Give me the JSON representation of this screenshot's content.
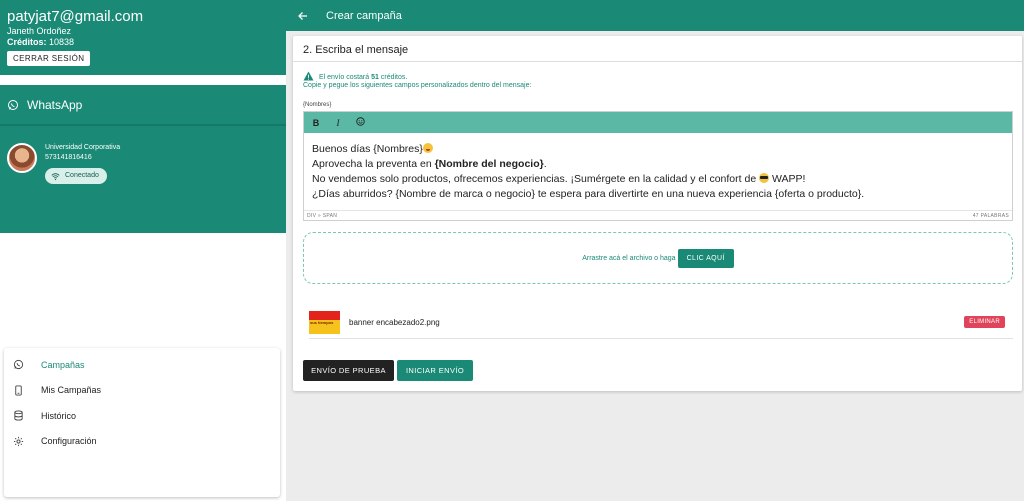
{
  "account": {
    "email": "patyjat7@gmail.com",
    "name": "Janeth Ordoñez",
    "credits_label": "Créditos:",
    "credits_value": "10838",
    "logout_label": "CERRAR SESIÓN"
  },
  "whatsapp": {
    "title": "WhatsApp",
    "org_name": "Universidad Corporativa",
    "phone": "573141816416",
    "status": "Conectado"
  },
  "menu": {
    "items": [
      {
        "label": "Campañas",
        "icon": "whatsapp-icon"
      },
      {
        "label": "Mis Campañas",
        "icon": "phone-icon"
      },
      {
        "label": "Histórico",
        "icon": "database-icon"
      },
      {
        "label": "Configuración",
        "icon": "gear-icon"
      }
    ]
  },
  "topbar": {
    "title": "Crear campaña"
  },
  "form": {
    "step_title": "2. Escriba el mensaje",
    "notice_prefix": "El envío costará",
    "notice_cost": "51",
    "notice_suffix": "créditos.",
    "notice_line2": "Copie y pegue los siguientes campos personalizados dentro del mensaje:",
    "field_tag": "{Nombres}",
    "toolbar": {
      "bold": "B",
      "italic": "I"
    },
    "message": {
      "line1": "Buenos días {Nombres}",
      "line2_prefix": "Aprovecha la preventa en",
      "line2_bold": "{Nombre del negocio}",
      "line2_suffix": ".",
      "line3_prefix": "No vendemos solo productos, ofrecemos experiencias. ¡Sumérgete en la calidad y el confort de",
      "line3_suffix": "WAPP!",
      "line4": "¿Días aburridos? {Nombre de marca o negocio} te espera para divertirte en una nueva experiencia {oferta o producto}."
    },
    "status_path": "DIV » SPAN",
    "word_count": "47 PALABRAS",
    "drop_text": "Arrastre acá el archivo o haga",
    "drop_button": "CLIC AQUÍ",
    "file": {
      "thumb_text": "sus tiempos",
      "name": "banner encabezado2.png",
      "delete_label": "ELIMINAR"
    },
    "test_button": "ENVÍO DE PRUEBA",
    "start_button": "INICIAR ENVÍO"
  },
  "colors": {
    "primary": "#1a8a76",
    "toolbar": "#5bb8a5",
    "danger": "#e0445a",
    "dark": "#222222"
  }
}
